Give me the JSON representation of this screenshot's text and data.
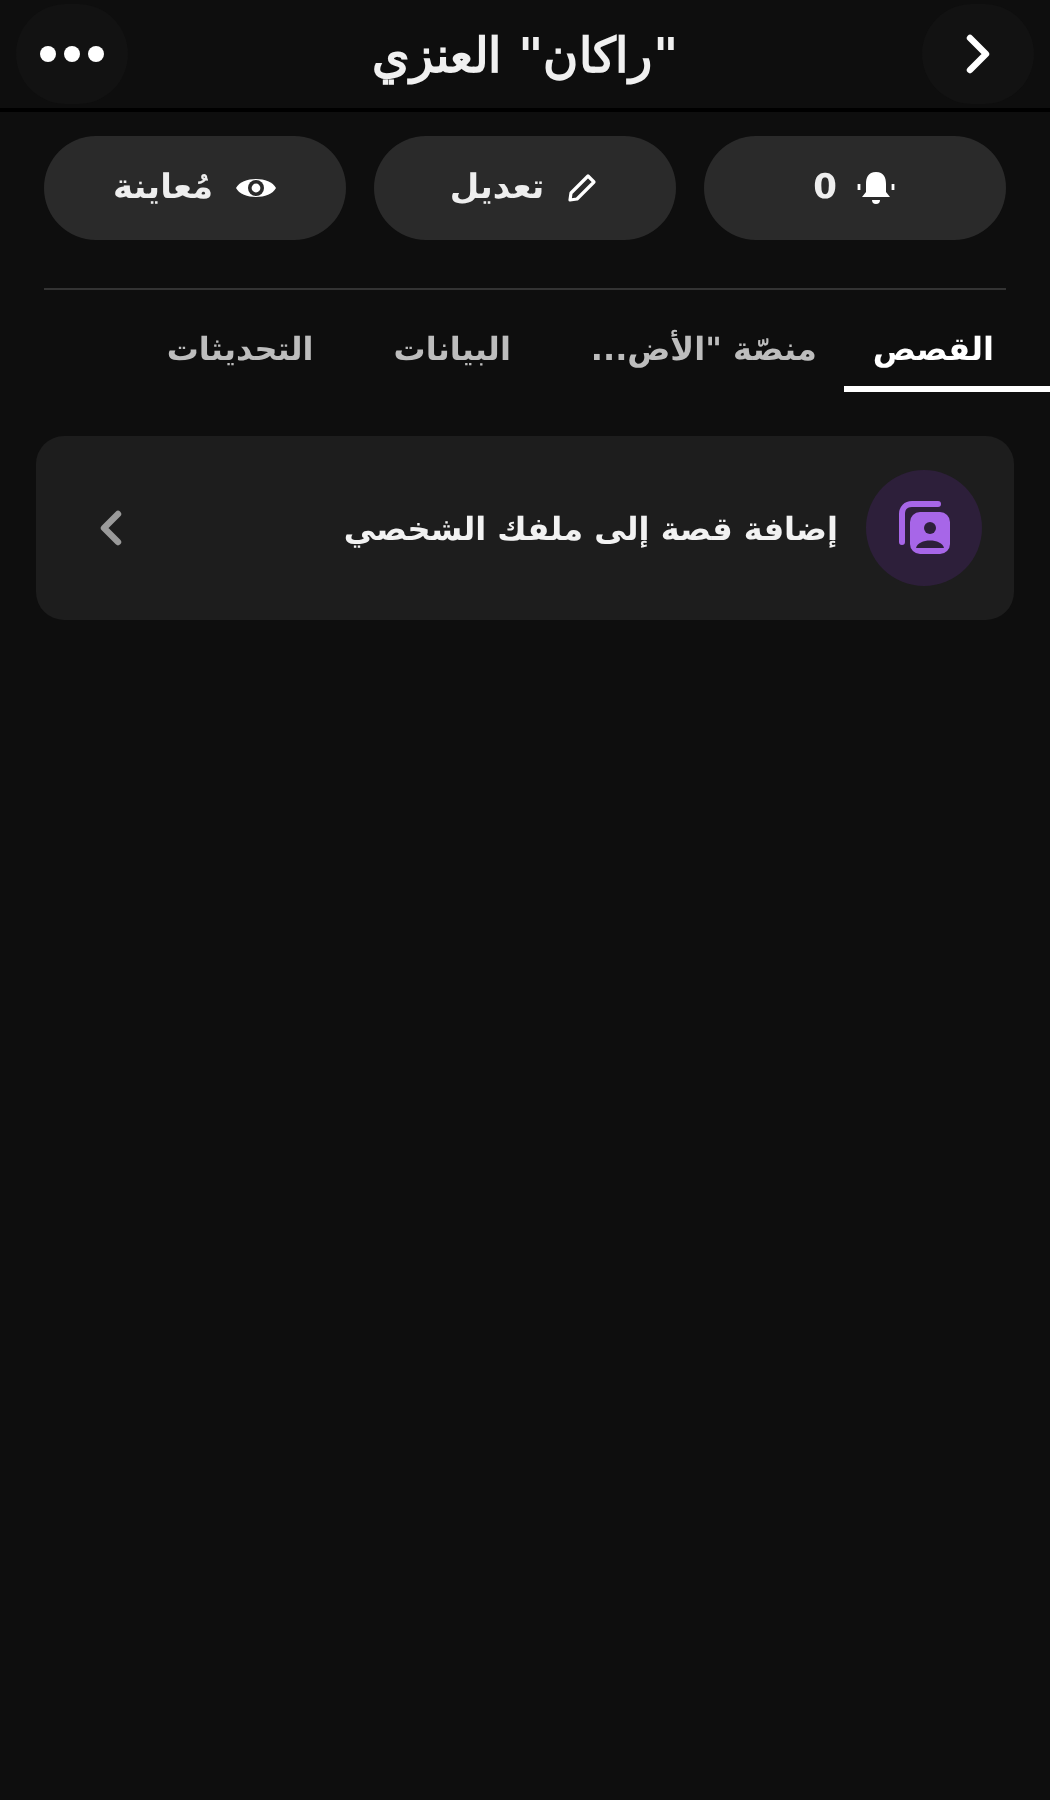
{
  "header": {
    "title": "\"راكان\" العنزي"
  },
  "actions": [
    {
      "kind": "notifications",
      "label": "0"
    },
    {
      "kind": "edit",
      "label": "تعديل"
    },
    {
      "kind": "preview",
      "label": "مُعاينة"
    }
  ],
  "tabs": [
    {
      "label": "القصص",
      "selected": true
    },
    {
      "label": "منصّة \"الأض...",
      "selected": false
    },
    {
      "label": "البيانات",
      "selected": false
    },
    {
      "label": "التحديثات",
      "selected": false
    }
  ],
  "story_card": {
    "label": "إضافة قصة إلى ملفك الشخصي"
  }
}
